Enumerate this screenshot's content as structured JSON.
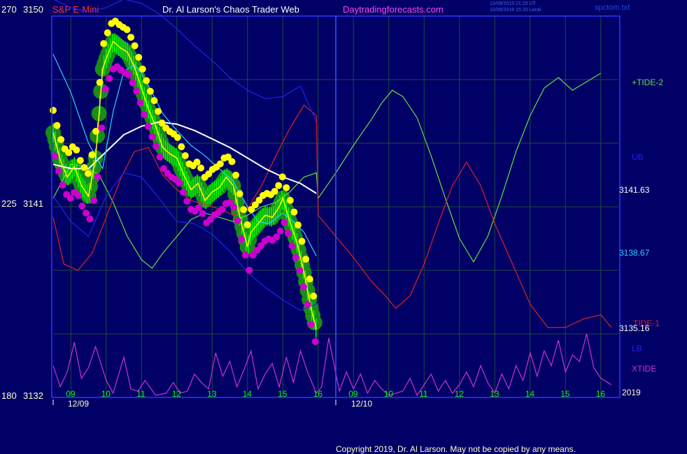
{
  "header": {
    "instrument": "S&P E-Mini",
    "site_title": "Dr. Al Larson's Chaos Trader Web",
    "site_url": "Daytradingforecasts.com",
    "timestamp_utc": "12/09/2019 21:20 UT",
    "timestamp_local": "12/09/2019 15:20 Local",
    "file_name": "spctom.txt"
  },
  "footer": {
    "copyright": "Copyright 2019, Dr. Al Larson. May not be copied by any means."
  },
  "colors": {
    "background": "#000066",
    "plot_border": "#3333ff",
    "grid": "#1f4a3c",
    "price_yellow": "#ffff00",
    "price_magenta": "#cc00cc",
    "green_bubble": "#1a8c1a",
    "bar_green": "#00ff00",
    "ma_white": "#ffffff",
    "ma_cyan": "#33ccff",
    "ub_lb_blue": "#2222ee",
    "tide1_red": "#dd2222",
    "tide2_green": "#66dd44",
    "xtide_magenta": "#cc33cc",
    "axis_text": "#ffffcc",
    "instrument_text": "#ff3333"
  },
  "chart_data": {
    "type": "line",
    "y_axis": {
      "left_labels": [
        {
          "index": "270",
          "price": "3150"
        },
        {
          "index": "225",
          "price": "3141"
        },
        {
          "index": "180",
          "price": "3132"
        }
      ],
      "ylim": [
        3132,
        3150
      ]
    },
    "x_axis": {
      "hour_labels": [
        "09",
        "10",
        "11",
        "12",
        "13",
        "14",
        "15",
        "16",
        "09",
        "10",
        "11",
        "12",
        "13",
        "14",
        "15",
        "16"
      ],
      "date_labels": [
        "12/09",
        "12/10"
      ],
      "year_label": "2019",
      "hour_range": [
        8.5,
        24.5
      ]
    },
    "right_labels": [
      {
        "text": "+TIDE-2",
        "color": "#66dd44"
      },
      {
        "text": "UB",
        "color": "#2222ee"
      },
      {
        "text": "3141.63",
        "color": "#ffffff"
      },
      {
        "text": "3138.67",
        "color": "#33ccff"
      },
      {
        "text": "TIDE-1",
        "color": "#dd2222"
      },
      {
        "text": "3135.16",
        "color": "#ffffff"
      },
      {
        "text": "LB",
        "color": "#2222ee"
      },
      {
        "text": "XTIDE",
        "color": "#cc33cc"
      }
    ],
    "series": [
      {
        "name": "Price",
        "color": "#ffff00",
        "x": [
          8.5,
          8.7,
          8.9,
          9.1,
          9.3,
          9.5,
          9.7,
          9.9,
          10.0,
          10.2,
          10.4,
          10.6,
          10.8,
          11.0,
          11.2,
          11.4,
          11.6,
          11.8,
          12.0,
          12.2,
          12.4,
          12.6,
          12.8,
          13.0,
          13.2,
          13.4,
          13.6,
          13.8,
          14.0,
          14.1,
          14.3,
          14.5,
          14.7,
          14.9,
          15.0,
          15.2,
          15.4,
          15.6,
          15.8,
          15.95
        ],
        "values": [
          3144.5,
          3143.2,
          3142.4,
          3142.9,
          3142.0,
          3141.5,
          3143.3,
          3147.5,
          3148.0,
          3148.8,
          3148.5,
          3148.3,
          3147.6,
          3146.6,
          3145.6,
          3144.8,
          3143.8,
          3143.5,
          3143.3,
          3142.5,
          3141.8,
          3142.1,
          3141.3,
          3141.7,
          3141.9,
          3142.4,
          3142.0,
          3140.4,
          3139.1,
          3139.8,
          3140.2,
          3140.6,
          3140.5,
          3141.0,
          3141.4,
          3140.3,
          3139.3,
          3137.9,
          3136.2,
          3135.2
        ]
      },
      {
        "name": "MA-white",
        "color": "#ffffff",
        "x": [
          8.5,
          9.0,
          9.5,
          10.0,
          10.5,
          11.0,
          11.5,
          12.0,
          12.5,
          13.0,
          13.5,
          14.0,
          14.5,
          15.0,
          15.5,
          15.95
        ],
        "values": [
          3143.0,
          3142.8,
          3142.8,
          3143.6,
          3144.4,
          3144.8,
          3145.0,
          3144.9,
          3144.6,
          3144.2,
          3143.8,
          3143.3,
          3142.8,
          3142.4,
          3142.1,
          3141.63
        ]
      },
      {
        "name": "MA-cyan",
        "color": "#33ccff",
        "x": [
          8.5,
          9.0,
          9.5,
          9.9,
          10.2,
          10.5,
          10.8,
          11.0,
          11.3,
          11.6,
          12.0,
          12.4,
          12.8,
          13.2,
          13.6,
          14.0,
          14.3,
          14.6,
          15.0,
          15.3,
          15.6,
          15.95
        ],
        "values": [
          3148.2,
          3146.4,
          3144.0,
          3142.8,
          3145.5,
          3147.4,
          3147.7,
          3147.3,
          3146.4,
          3145.4,
          3144.6,
          3143.9,
          3143.4,
          3142.8,
          3142.2,
          3141.0,
          3140.3,
          3140.2,
          3140.7,
          3140.3,
          3139.8,
          3138.67
        ]
      },
      {
        "name": "UB",
        "color": "#2222ee",
        "x": [
          8.5,
          9.0,
          9.5,
          10.0,
          10.5,
          11.0,
          11.5,
          12.0,
          12.5,
          13.0,
          13.5,
          14.0,
          14.5,
          15.0,
          15.5,
          15.95
        ],
        "values": [
          3150.8,
          3150.4,
          3150.2,
          3150.4,
          3150.8,
          3150.6,
          3150.1,
          3149.4,
          3148.6,
          3147.9,
          3147.1,
          3146.5,
          3146.1,
          3146.2,
          3146.7,
          3145.0
        ]
      },
      {
        "name": "LB",
        "color": "#2222ee",
        "x": [
          8.5,
          9.0,
          9.5,
          10.0,
          10.5,
          11.0,
          11.5,
          12.0,
          12.5,
          13.0,
          13.5,
          14.0,
          14.5,
          15.0,
          15.5,
          15.95
        ],
        "values": [
          3141.5,
          3140.3,
          3139.6,
          3141.5,
          3142.6,
          3142.4,
          3141.4,
          3140.3,
          3140.2,
          3139.7,
          3138.9,
          3137.9,
          3137.2,
          3136.6,
          3136.1,
          3136.4
        ]
      },
      {
        "name": "TIDE-1",
        "color": "#dd2222",
        "x": [
          8.5,
          8.8,
          9.2,
          9.6,
          10.0,
          10.4,
          10.8,
          11.2,
          11.6,
          12.0,
          12.4,
          12.8,
          13.2,
          13.6,
          14.0,
          14.4,
          14.8,
          15.2,
          15.6,
          15.95,
          16.0,
          16.5,
          17.0,
          17.5,
          17.9,
          18.2,
          18.6,
          19.0,
          19.4,
          19.8,
          20.2,
          20.6,
          21.0,
          21.5,
          22.0,
          22.5,
          23.0,
          23.5,
          24.0,
          24.3
        ],
        "values": [
          3140.5,
          3138.3,
          3138.0,
          3138.8,
          3140.5,
          3142.3,
          3143.6,
          3143.8,
          3142.5,
          3141.8,
          3141.3,
          3141.1,
          3140.9,
          3140.6,
          3140.9,
          3142.0,
          3143.4,
          3144.7,
          3145.8,
          3145.3,
          3140.6,
          3139.6,
          3138.6,
          3137.5,
          3136.8,
          3136.2,
          3136.8,
          3138.3,
          3140.2,
          3142.0,
          3143.1,
          3142.0,
          3140.2,
          3138.3,
          3136.4,
          3135.3,
          3135.3,
          3135.7,
          3135.9,
          3135.3
        ]
      },
      {
        "name": "+TIDE-2",
        "color": "#66dd44",
        "x": [
          8.5,
          9.0,
          9.4,
          9.8,
          10.2,
          10.6,
          11.0,
          11.3,
          11.6,
          12.0,
          12.4,
          12.8,
          13.2,
          13.6,
          14.0,
          14.4,
          14.8,
          15.2,
          15.6,
          15.95,
          16.0,
          16.5,
          17.0,
          17.5,
          17.8,
          18.1,
          18.4,
          18.8,
          19.2,
          19.6,
          20.0,
          20.4,
          20.8,
          21.2,
          21.6,
          22.0,
          22.4,
          22.8,
          23.2,
          23.6,
          24.0
        ],
        "values": [
          3141.4,
          3143.0,
          3142.9,
          3142.5,
          3141.2,
          3139.6,
          3138.5,
          3138.1,
          3138.8,
          3139.6,
          3140.4,
          3140.7,
          3140.5,
          3140.3,
          3140.6,
          3141.0,
          3141.2,
          3141.7,
          3142.4,
          3142.6,
          3141.4,
          3142.6,
          3143.9,
          3145.1,
          3145.9,
          3146.5,
          3146.2,
          3145.2,
          3143.4,
          3141.4,
          3139.5,
          3138.4,
          3139.6,
          3141.5,
          3143.6,
          3145.3,
          3146.6,
          3147.1,
          3146.5,
          3146.9,
          3147.3
        ]
      },
      {
        "name": "XTIDE",
        "color": "#cc33cc",
        "x": [
          8.5,
          8.7,
          8.9,
          9.1,
          9.3,
          9.5,
          9.7,
          10.0,
          10.2,
          10.5,
          10.7,
          10.9,
          11.1,
          11.4,
          11.7,
          11.9,
          12.1,
          12.3,
          12.5,
          12.7,
          12.9,
          13.1,
          13.3,
          13.5,
          13.7,
          13.9,
          14.1,
          14.3,
          14.5,
          14.7,
          14.9,
          15.1,
          15.3,
          15.5,
          15.7,
          15.95,
          16.1,
          16.3,
          16.6,
          16.8,
          17.0,
          17.2,
          17.4,
          17.6,
          17.8,
          18.0,
          18.2,
          18.4,
          18.6,
          18.8,
          19.0,
          19.2,
          19.4,
          19.6,
          19.8,
          20.0,
          20.2,
          20.4,
          20.6,
          20.8,
          21.0,
          21.2,
          21.4,
          21.6,
          21.8,
          22.0,
          22.2,
          22.4,
          22.6,
          22.8,
          23.0,
          23.2,
          23.4,
          23.6,
          23.8,
          24.0,
          24.3
        ],
        "values": [
          3133.5,
          3132.5,
          3133.2,
          3134.6,
          3132.9,
          3133.4,
          3134.4,
          3132.8,
          3132.2,
          3133.9,
          3132.4,
          3132.3,
          3132.8,
          3132.1,
          3132.2,
          3132.7,
          3132.2,
          3132.3,
          3133.1,
          3132.7,
          3132.4,
          3134.1,
          3133.0,
          3133.7,
          3132.5,
          3133.3,
          3134.2,
          3132.4,
          3133.1,
          3133.6,
          3132.5,
          3133.9,
          3132.7,
          3134.2,
          3133.2,
          3132.2,
          3132.5,
          3134.8,
          3132.3,
          3133.2,
          3132.4,
          3133.1,
          3132.2,
          3132.8,
          3132.4,
          3132.1,
          3132.2,
          3132.3,
          3132.9,
          3132.1,
          3132.6,
          3133.1,
          3132.3,
          3132.8,
          3132.2,
          3132.6,
          3133.2,
          3132.5,
          3133.5,
          3132.7,
          3132.2,
          3133.1,
          3132.4,
          3133.5,
          3132.8,
          3134.1,
          3133.0,
          3134.2,
          3133.5,
          3134.7,
          3133.2,
          3134.0,
          3133.7,
          3135.0,
          3133.4,
          3132.9,
          3132.6
        ]
      }
    ],
    "grid": true,
    "legend": "right"
  }
}
